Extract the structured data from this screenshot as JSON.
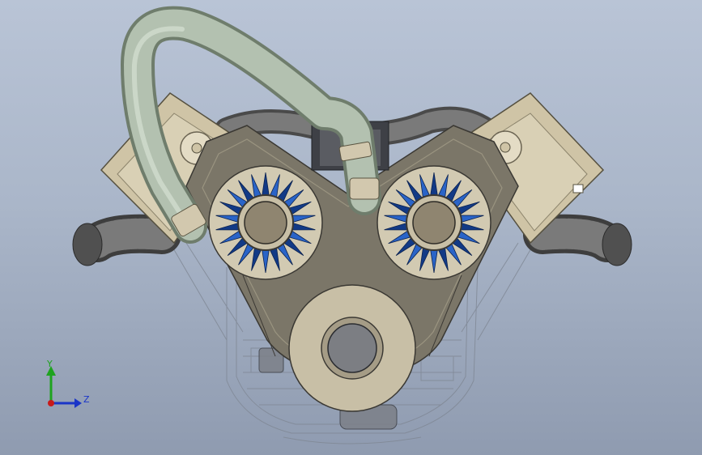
{
  "viewport": {
    "background_top": "#b9c4d6",
    "background_bottom": "#8f9bb0"
  },
  "model": {
    "colors": {
      "housing": "#7b7668",
      "housing_edge": "#3a3833",
      "cam_cover": "#cfc4a6",
      "pulley": "#c8bfa6",
      "hub": "#8f8570",
      "gear_blue": "#2a64c8",
      "gear_blue_dark": "#123a86",
      "tube": "#b3c1b0",
      "hose": "#6d6d6d",
      "wireframe": "#8a8f99"
    },
    "gear_teeth": 22
  },
  "triad": {
    "y_label": "Y",
    "z_label": "Z",
    "y_color": "#1fa31f",
    "z_color": "#1a35c8",
    "x_color": "#c81a1a"
  }
}
